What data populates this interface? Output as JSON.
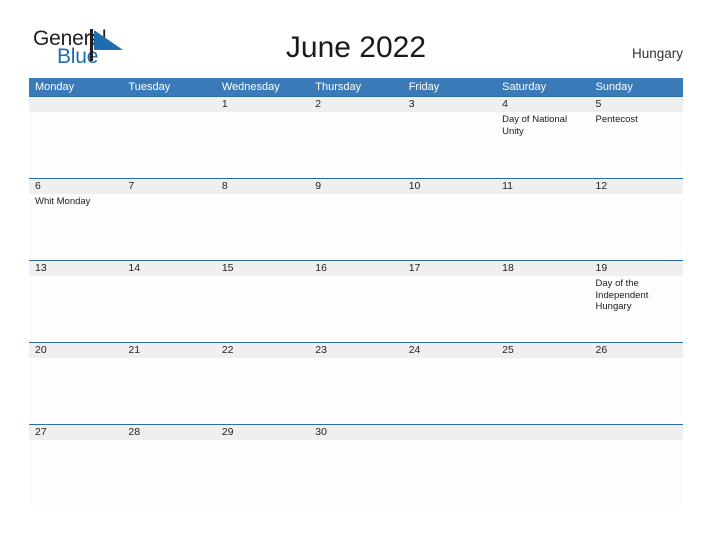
{
  "brand": {
    "name_part1": "General",
    "name_part2": "Blue",
    "flag_icon": "flag-triangle-icon",
    "colors": {
      "blue": "#1f6cb0",
      "dark": "#231f20"
    }
  },
  "header": {
    "title": "June 2022",
    "country": "Hungary"
  },
  "calendar": {
    "colors": {
      "header_blue": "#3b7ab8",
      "row_separator": "#2e6da4",
      "daynum_band": "#efeff0",
      "cell_background": "#fdfdfd"
    },
    "weekdays": [
      "Monday",
      "Tuesday",
      "Wednesday",
      "Thursday",
      "Friday",
      "Saturday",
      "Sunday"
    ],
    "weeks": [
      {
        "days": [
          {
            "num": "",
            "event": ""
          },
          {
            "num": "",
            "event": ""
          },
          {
            "num": "1",
            "event": ""
          },
          {
            "num": "2",
            "event": ""
          },
          {
            "num": "3",
            "event": ""
          },
          {
            "num": "4",
            "event": "Day of National Unity"
          },
          {
            "num": "5",
            "event": "Pentecost"
          }
        ]
      },
      {
        "days": [
          {
            "num": "6",
            "event": "Whit Monday"
          },
          {
            "num": "7",
            "event": ""
          },
          {
            "num": "8",
            "event": ""
          },
          {
            "num": "9",
            "event": ""
          },
          {
            "num": "10",
            "event": ""
          },
          {
            "num": "11",
            "event": ""
          },
          {
            "num": "12",
            "event": ""
          }
        ]
      },
      {
        "days": [
          {
            "num": "13",
            "event": ""
          },
          {
            "num": "14",
            "event": ""
          },
          {
            "num": "15",
            "event": ""
          },
          {
            "num": "16",
            "event": ""
          },
          {
            "num": "17",
            "event": ""
          },
          {
            "num": "18",
            "event": ""
          },
          {
            "num": "19",
            "event": "Day of the Independent Hungary"
          }
        ]
      },
      {
        "days": [
          {
            "num": "20",
            "event": ""
          },
          {
            "num": "21",
            "event": ""
          },
          {
            "num": "22",
            "event": ""
          },
          {
            "num": "23",
            "event": ""
          },
          {
            "num": "24",
            "event": ""
          },
          {
            "num": "25",
            "event": ""
          },
          {
            "num": "26",
            "event": ""
          }
        ]
      },
      {
        "days": [
          {
            "num": "27",
            "event": ""
          },
          {
            "num": "28",
            "event": ""
          },
          {
            "num": "29",
            "event": ""
          },
          {
            "num": "30",
            "event": ""
          },
          {
            "num": "",
            "event": ""
          },
          {
            "num": "",
            "event": ""
          },
          {
            "num": "",
            "event": ""
          }
        ]
      }
    ]
  }
}
